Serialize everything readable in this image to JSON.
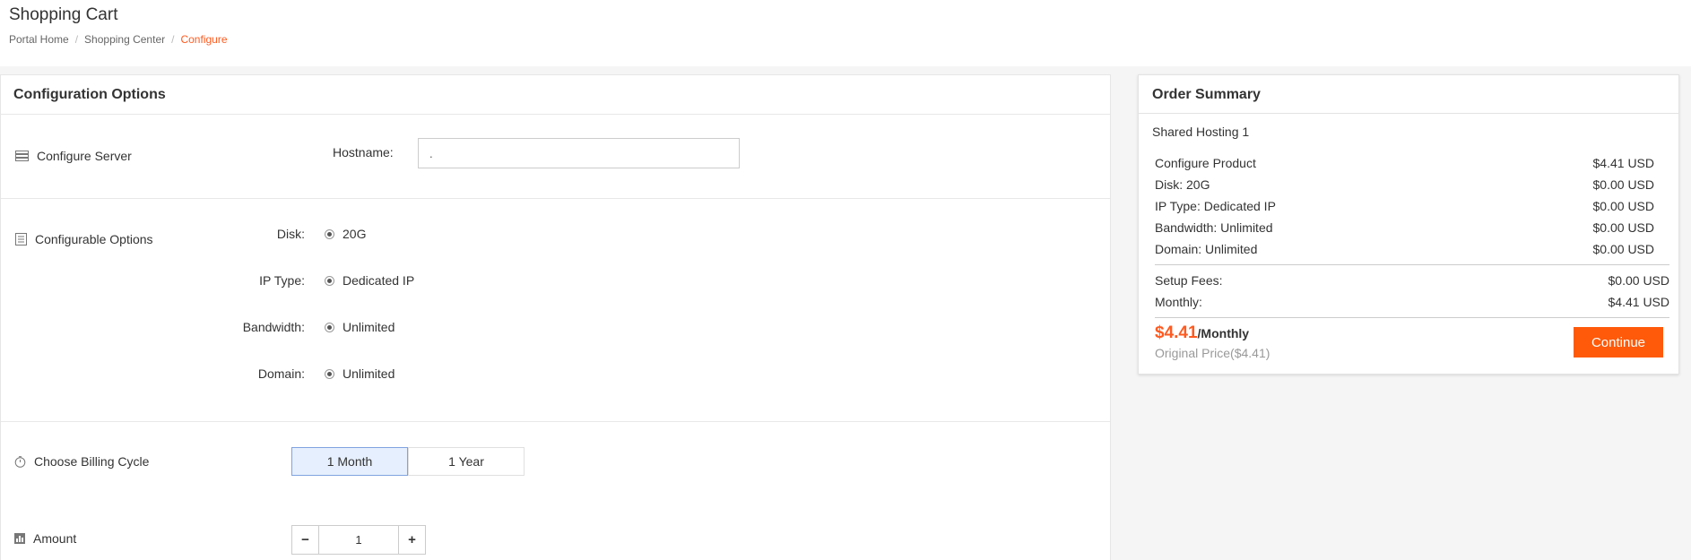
{
  "header": {
    "title": "Shopping Cart",
    "breadcrumb": {
      "home": "Portal Home",
      "section": "Shopping Center",
      "current": "Configure"
    }
  },
  "config": {
    "heading": "Configuration Options",
    "server_section": {
      "label": "Configure Server",
      "icon": "server-icon",
      "hostname_label": "Hostname:",
      "hostname_value": "."
    },
    "options_section": {
      "label": "Configurable Options",
      "icon": "list-icon",
      "options": [
        {
          "label": "Disk:",
          "value": "20G"
        },
        {
          "label": "IP Type:",
          "value": "Dedicated IP"
        },
        {
          "label": "Bandwidth:",
          "value": "Unlimited"
        },
        {
          "label": "Domain:",
          "value": "Unlimited"
        }
      ]
    },
    "billing_section": {
      "label": "Choose Billing Cycle",
      "icon": "clock-icon",
      "cycles": [
        "1 Month",
        "1 Year"
      ],
      "selected": "1 Month"
    },
    "amount_section": {
      "label": "Amount",
      "icon": "bar-chart-icon",
      "minus": "−",
      "plus": "+",
      "value": "1"
    }
  },
  "summary": {
    "heading": "Order Summary",
    "product": "Shared Hosting 1",
    "items": [
      {
        "label": "Configure Product",
        "price": "$4.41 USD"
      },
      {
        "label": "Disk: 20G",
        "price": "$0.00 USD"
      },
      {
        "label": "IP Type: Dedicated IP",
        "price": "$0.00 USD"
      },
      {
        "label": "Bandwidth: Unlimited",
        "price": "$0.00 USD"
      },
      {
        "label": "Domain: Unlimited",
        "price": "$0.00 USD"
      }
    ],
    "fees": [
      {
        "label": "Setup Fees:",
        "price": "$0.00 USD"
      },
      {
        "label": "Monthly:",
        "price": "$4.41 USD"
      }
    ],
    "total_amount": "$4.41",
    "total_period": "/Monthly",
    "original_price": "Original Price($4.41)",
    "continue_label": "Continue"
  },
  "colors": {
    "accent": "#ff5a1f",
    "button": "#ff5a0a",
    "active_cycle_bg": "#e6effd"
  }
}
